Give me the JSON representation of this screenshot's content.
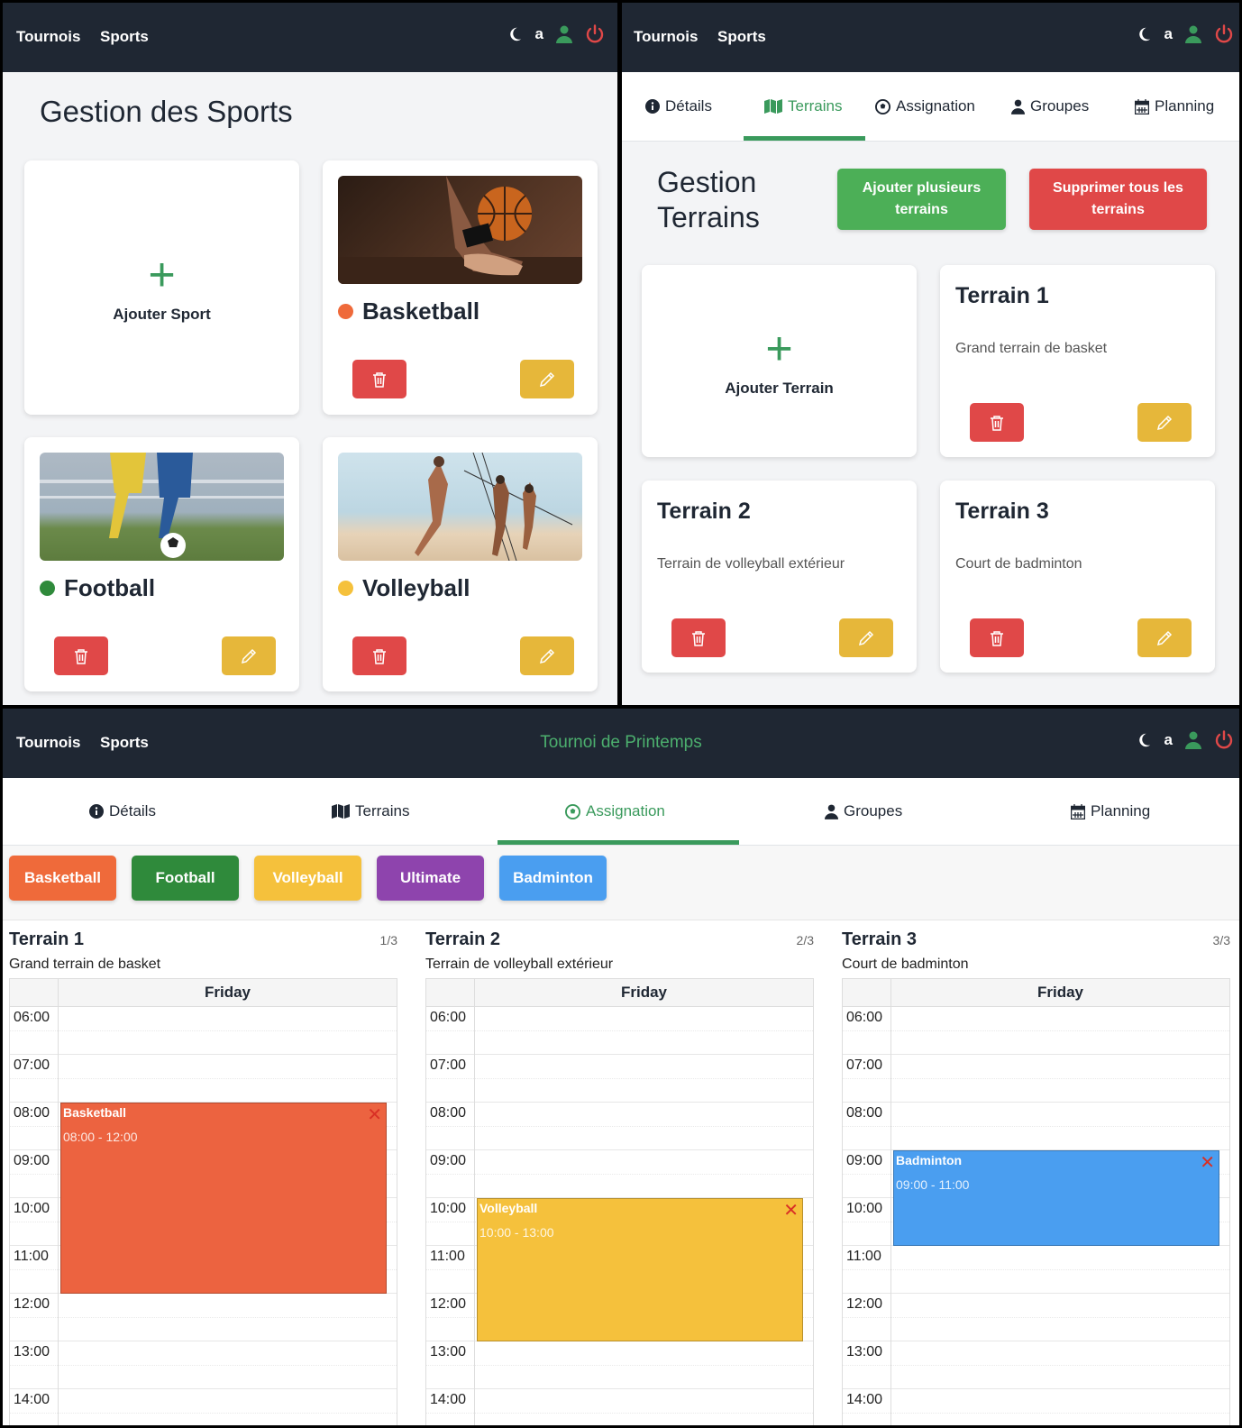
{
  "nav": {
    "tournois": "Tournois",
    "sports": "Sports",
    "user_letter": "a"
  },
  "colors": {
    "navbar": "#1f2733",
    "green": "#3a9a5c",
    "red": "#e04848",
    "yellow": "#e6b73a"
  },
  "sports_page": {
    "title": "Gestion des Sports",
    "add_label": "Ajouter Sport",
    "sports": [
      {
        "name": "Basketball",
        "color": "#ef6a3a"
      },
      {
        "name": "Football",
        "color": "#2f8a3b"
      },
      {
        "name": "Volleyball",
        "color": "#f5c13c"
      }
    ]
  },
  "terrains_page": {
    "tabs": [
      "Détails",
      "Terrains",
      "Assignation",
      "Groupes",
      "Planning"
    ],
    "active_tab": "Terrains",
    "title_line1": "Gestion",
    "title_line2": "Terrains",
    "add_many_label": "Ajouter plusieurs terrains",
    "delete_all_label": "Supprimer tous les terrains",
    "add_label": "Ajouter Terrain",
    "terrains": [
      {
        "name": "Terrain 1",
        "desc": "Grand terrain de basket"
      },
      {
        "name": "Terrain 2",
        "desc": "Terrain de volleyball extérieur"
      },
      {
        "name": "Terrain 3",
        "desc": "Court de badminton"
      }
    ]
  },
  "assign_page": {
    "tournament": "Tournoi de Printemps",
    "tabs": [
      "Détails",
      "Terrains",
      "Assignation",
      "Groupes",
      "Planning"
    ],
    "active_tab": "Assignation",
    "chips": [
      {
        "label": "Basketball",
        "color": "#ef6a3a"
      },
      {
        "label": "Football",
        "color": "#2f8a3b"
      },
      {
        "label": "Volleyball",
        "color": "#f5c13c"
      },
      {
        "label": "Ultimate",
        "color": "#8e44ad"
      },
      {
        "label": "Badminton",
        "color": "#4a9ef0"
      }
    ],
    "day": "Friday",
    "hours": [
      "06:00",
      "07:00",
      "08:00",
      "09:00",
      "10:00",
      "11:00",
      "12:00",
      "13:00",
      "14:00"
    ],
    "columns": [
      {
        "name": "Terrain 1",
        "count": "1/3",
        "desc": "Grand terrain de basket",
        "event": {
          "name": "Basketball",
          "time": "08:00 - 12:00",
          "start": 8,
          "end": 12,
          "color": "#ec6340"
        }
      },
      {
        "name": "Terrain 2",
        "count": "2/3",
        "desc": "Terrain de volleyball extérieur",
        "event": {
          "name": "Volleyball",
          "time": "10:00 - 13:00",
          "start": 10,
          "end": 13,
          "color": "#f5c13c"
        }
      },
      {
        "name": "Terrain 3",
        "count": "3/3",
        "desc": "Court de badminton",
        "event": {
          "name": "Badminton",
          "time": "09:00 - 11:00",
          "start": 9,
          "end": 11,
          "color": "#4a9ef0"
        }
      }
    ]
  }
}
